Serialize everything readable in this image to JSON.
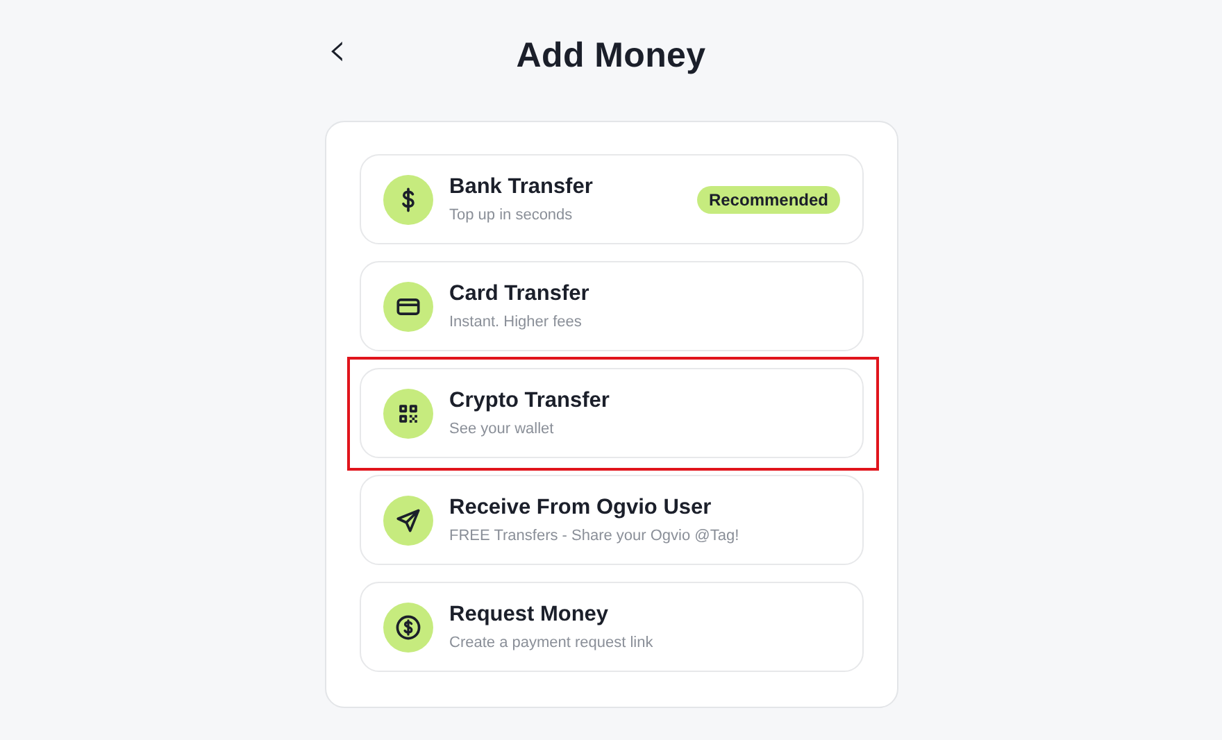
{
  "header": {
    "back": "‹",
    "title": "Add Money"
  },
  "options": [
    {
      "kind": "dollar",
      "title": "Bank Transfer",
      "subtitle": "Top up in seconds",
      "badge": "Recommended",
      "highlighted": false
    },
    {
      "kind": "card",
      "title": "Card Transfer",
      "subtitle": "Instant. Higher fees",
      "highlighted": false
    },
    {
      "kind": "qr",
      "title": "Crypto Transfer",
      "subtitle": "See your wallet",
      "highlighted": true
    },
    {
      "kind": "send",
      "title": "Receive From Ogvio User",
      "subtitle": "FREE Transfers - Share your Ogvio @Tag!",
      "highlighted": false
    },
    {
      "kind": "coin",
      "title": "Request Money",
      "subtitle": "Create a payment request link",
      "highlighted": false
    }
  ]
}
